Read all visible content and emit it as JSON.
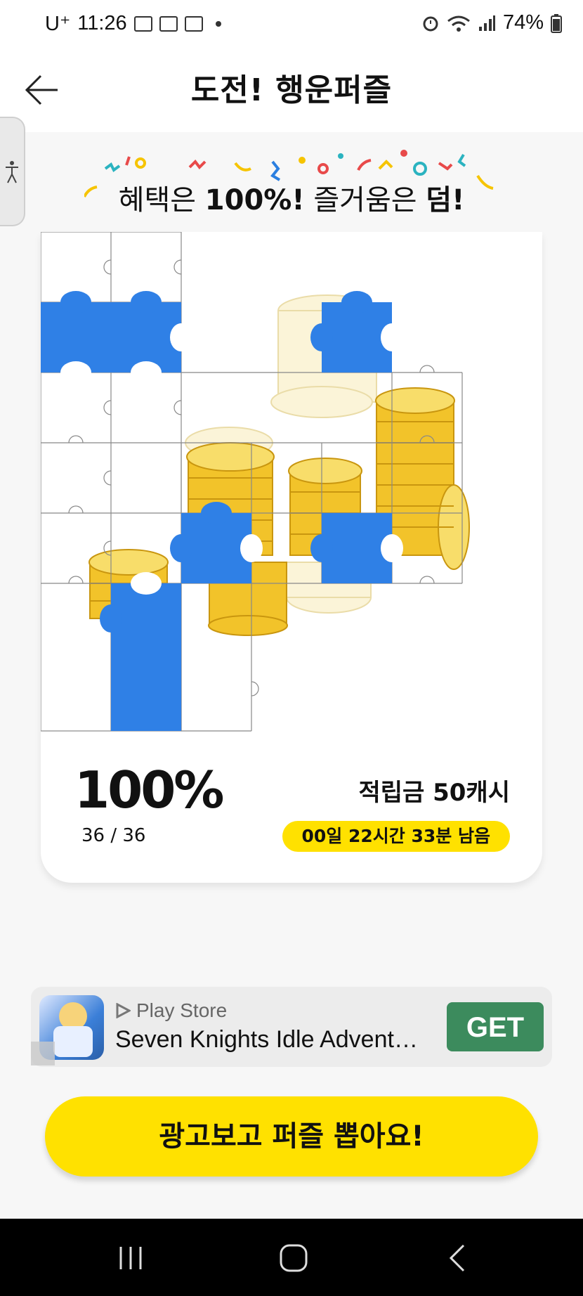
{
  "status_bar": {
    "carrier": "U⁺",
    "time": "11:26",
    "battery": "74%"
  },
  "header": {
    "title": "도전! 행운퍼즐"
  },
  "slogan": {
    "part1": "혜택은 ",
    "bold1": "100%!",
    "part2": " 즐거움은 ",
    "bold2": "덤!"
  },
  "puzzle": {
    "rows": 6,
    "cols": 6,
    "collected": 36,
    "total": 36,
    "piece_color": "#2f80e6"
  },
  "progress": {
    "percent": "100%",
    "count": "36 / 36",
    "value": 1.0
  },
  "reward": {
    "label": "적립금 50캐시"
  },
  "timer": {
    "label": "00일 22시간 33분 남음"
  },
  "ad": {
    "store": "Play Store",
    "title": "Seven Knights Idle Advent…",
    "get_label": "GET"
  },
  "cta": {
    "label": "광고보고 퍼즐 뽑아요!"
  },
  "colors": {
    "accent_yellow": "#ffe100",
    "puzzle_blue": "#2f80e6",
    "ad_green": "#3c8b5d"
  }
}
